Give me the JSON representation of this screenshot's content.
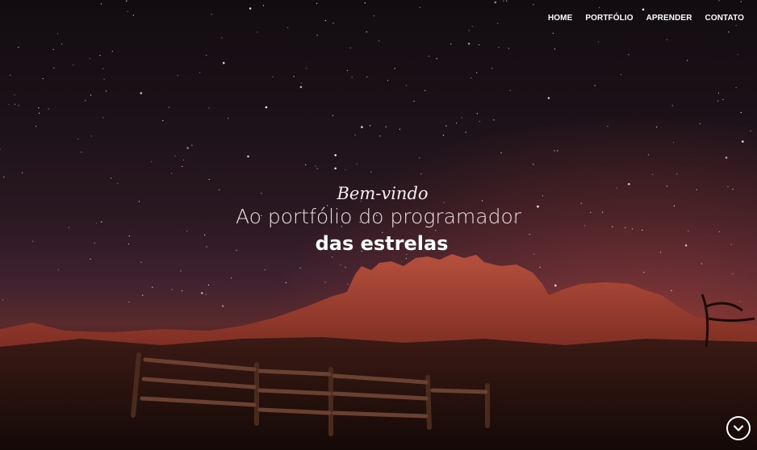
{
  "nav": {
    "items": [
      {
        "label": "HOME"
      },
      {
        "label": "PORTFÓLIO"
      },
      {
        "label": "APRENDER"
      },
      {
        "label": "CONTATO"
      }
    ]
  },
  "hero": {
    "welcome": "Bem-vindo",
    "subtitle": "Ao portfólio do programador",
    "emphasis": "das estrelas",
    "background": "starry night sky over desert mountains with wooden fence"
  },
  "scroll_button": {
    "icon": "chevron-down-icon"
  },
  "colors": {
    "sky_top": "#120c10",
    "sky_mid": "#2a1821",
    "mountain": "#7a2c22",
    "text": "#ffffff"
  }
}
